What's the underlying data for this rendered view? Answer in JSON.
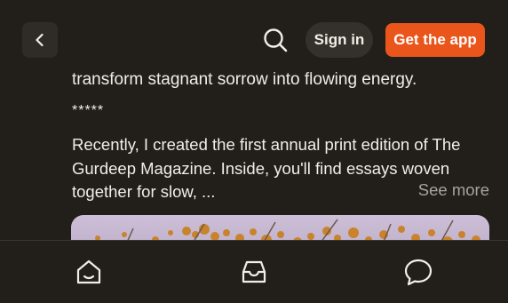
{
  "header": {
    "signin_label": "Sign in",
    "getapp_label": "Get the app",
    "icons": [
      "back-chevron-icon",
      "search-icon"
    ],
    "accent_color": "#e9551b"
  },
  "post": {
    "prev_line": "transform stagnant sorrow into flowing energy.",
    "separator": "*****",
    "paragraph": "Recently, I created the first annual print edition of The Gurdeep Magazine. Inside, you'll find essays woven together for slow, ...",
    "see_more_label": "See more"
  },
  "bottom_nav": {
    "icons": [
      "home-icon",
      "inbox-icon",
      "chat-icon"
    ]
  }
}
